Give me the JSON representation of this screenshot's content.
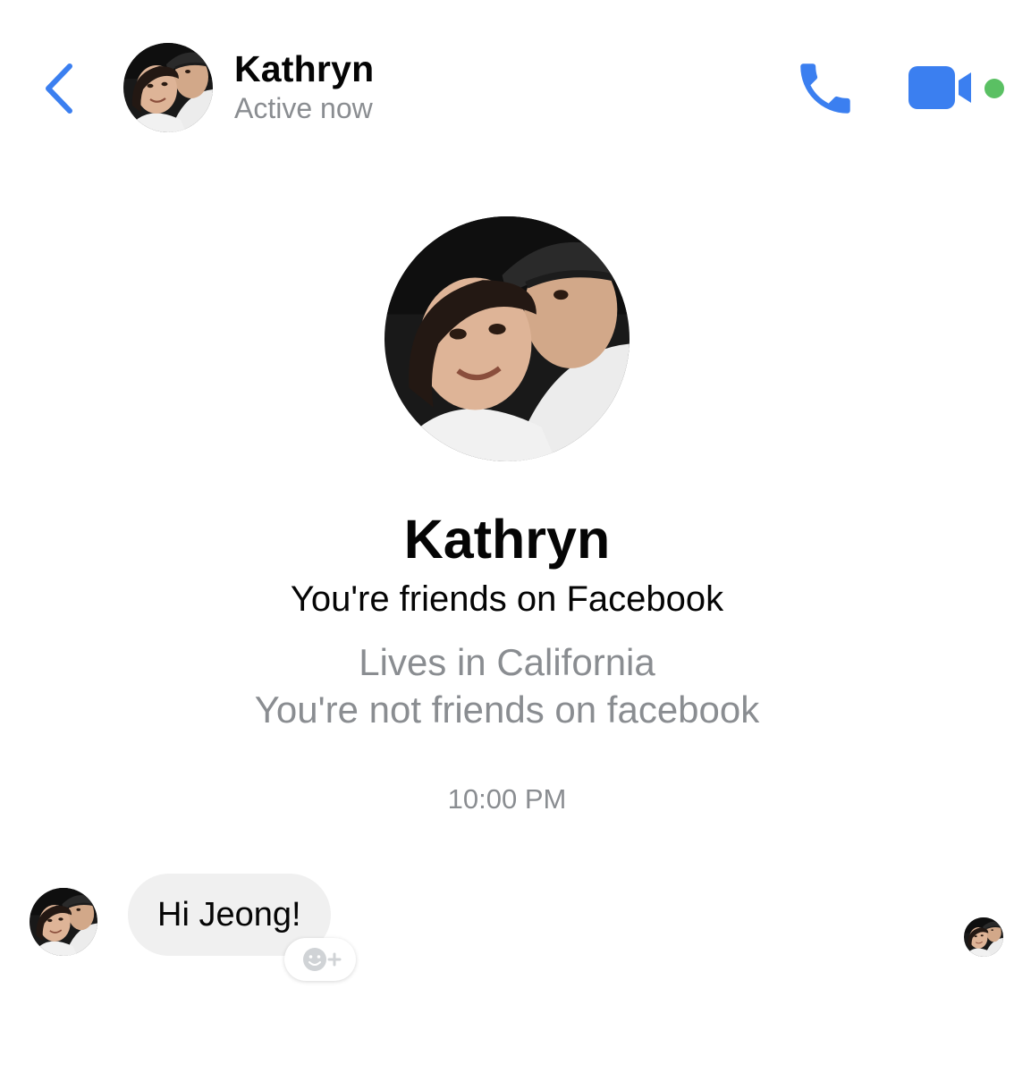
{
  "header": {
    "contact_name": "Kathryn",
    "status": "Active now",
    "icons": {
      "back": "chevron-left-icon",
      "call": "phone-icon",
      "video": "video-camera-icon"
    },
    "accent_color": "#3b7ff0",
    "online_color": "#5ac063"
  },
  "profile": {
    "name": "Kathryn",
    "friends_status": "You're friends on Facebook",
    "location": "Lives in California",
    "note": "You're not friends on facebook"
  },
  "conversation": {
    "timestamp": "10:00 PM",
    "messages": [
      {
        "sender": "Kathryn",
        "text": "Hi Jeong!"
      }
    ],
    "reaction_icon": "add-reaction-icon",
    "bubble_color": "#f0f0f0"
  }
}
